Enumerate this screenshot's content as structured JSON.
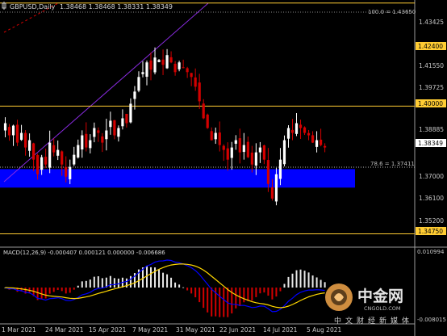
{
  "header": {
    "symbol_label": "GBPUSD,Daily",
    "ohlc": "1.38468 1.38468 1.38331 1.38349"
  },
  "price_levels": [
    {
      "value": 1.4424,
      "label": "1.42400",
      "color": "#ffcc33",
      "boxed": true
    },
    {
      "value": 1.4,
      "label": "1.40000",
      "color": "#ffcc33",
      "boxed": true
    },
    {
      "value": 1.3475,
      "label": "1.34750",
      "color": "#ffcc33",
      "boxed": true
    }
  ],
  "current_price": {
    "value": 1.38349,
    "label": "1.38349"
  },
  "fib_labels": [
    {
      "text": "100.0 = 1.43650",
      "value": 1.4365
    },
    {
      "text": "78.6 = 1.37411",
      "value": 1.37411
    }
  ],
  "y_axis_ticks": [
    "1.43425",
    "1.41550",
    "1.39725",
    "1.38885",
    "1.37000",
    "1.36100",
    "1.35200"
  ],
  "x_axis_ticks": [
    "1 Mar 2021",
    "24 Mar 2021",
    "15 Apr 2021",
    "7 May 2021",
    "31 May 2021",
    "22 Jun 2021",
    "14 Jul 2021",
    "5 Aug 2021"
  ],
  "macd": {
    "label": "MACD(12,26,9) -0.000407 0.000121 0.000000 -0.006686",
    "axis_top": "0.010994",
    "axis_bottom": "-0.008015"
  },
  "watermark": {
    "brand": "中金网",
    "domain": "CNGOLD.COM",
    "tagline": "中文财经新媒体"
  },
  "colors": {
    "background": "#000000",
    "bull": "#ffffff",
    "bear": "#d40000",
    "level_line": "#ffcc33",
    "zone": "#0000ff",
    "trendline": "#8a2be2",
    "grid_text": "#c8c8c8"
  },
  "chart_data": {
    "type": "candlestick",
    "symbol": "GBPUSD",
    "timeframe": "Daily",
    "x": [
      "1 Mar 2021",
      "24 Mar 2021",
      "15 Apr 2021",
      "7 May 2021",
      "31 May 2021",
      "22 Jun 2021",
      "14 Jul 2021",
      "5 Aug 2021"
    ],
    "ylim": [
      1.344,
      1.443
    ],
    "levels": [
      1.4424,
      1.4,
      1.3475
    ],
    "demand_zone": [
      1.3665,
      1.3741
    ],
    "fib": {
      "100.0": 1.4365,
      "78.6": 1.37411
    },
    "close_path": [
      1.393,
      1.388,
      1.392,
      1.385,
      1.389,
      1.383,
      1.386,
      1.378,
      1.372,
      1.379,
      1.376,
      1.385,
      1.381,
      1.382,
      1.376,
      1.371,
      1.375,
      1.38,
      1.384,
      1.388,
      1.383,
      1.386,
      1.391,
      1.389,
      1.385,
      1.39,
      1.394,
      1.388,
      1.391,
      1.395,
      1.393,
      1.401,
      1.406,
      1.412,
      1.414,
      1.418,
      1.415,
      1.42,
      1.419,
      1.417,
      1.421,
      1.418,
      1.414,
      1.418,
      1.416,
      1.414,
      1.412,
      1.408,
      1.402,
      1.395,
      1.391,
      1.386,
      1.389,
      1.384,
      1.382,
      1.378,
      1.383,
      1.386,
      1.381,
      1.384,
      1.379,
      1.376,
      1.381,
      1.383,
      1.378,
      1.368,
      1.362,
      1.372,
      1.378,
      1.386,
      1.391,
      1.389,
      1.393,
      1.391,
      1.389,
      1.388,
      1.385,
      1.386,
      1.384,
      1.383
    ]
  }
}
